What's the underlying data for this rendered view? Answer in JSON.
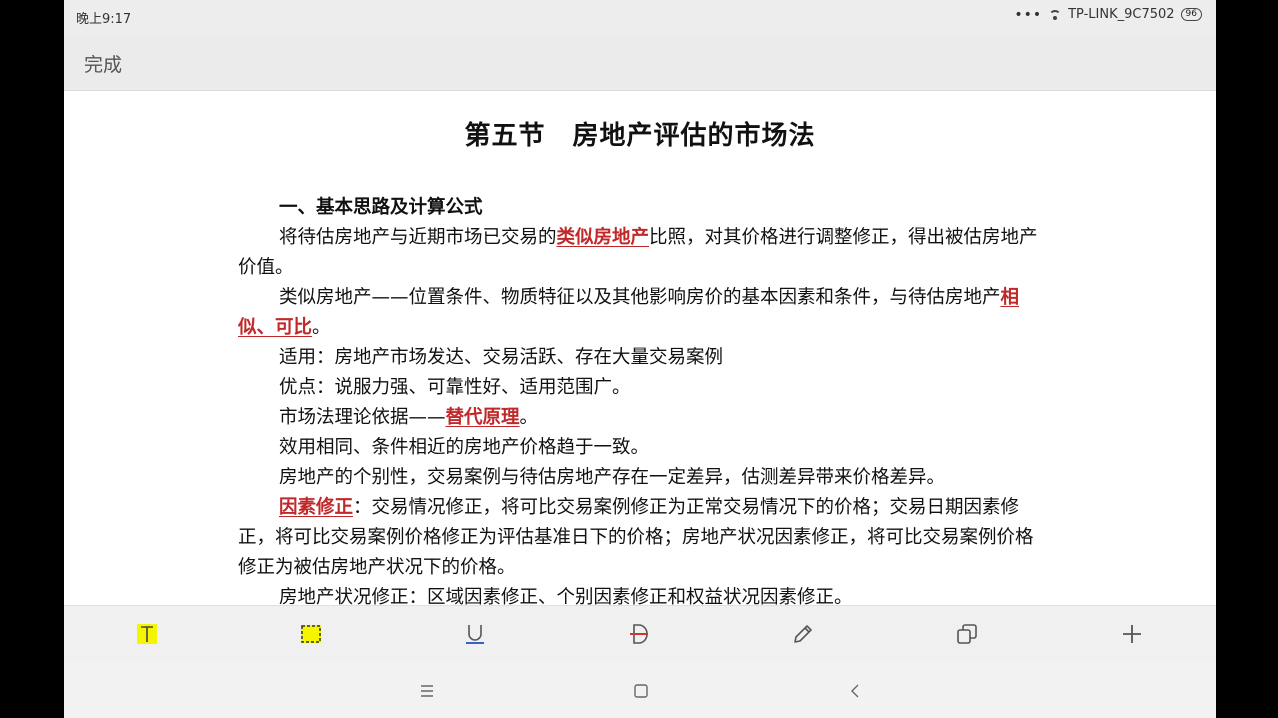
{
  "status": {
    "time": "晚上9:17",
    "more": "•••",
    "wifi_name": "TP-LINK_9C7502",
    "battery": "96"
  },
  "top_bar": {
    "done_label": "完成"
  },
  "document": {
    "title": "第五节　房地产评估的市场法",
    "heading1": "一、基本思路及计算公式",
    "p1": {
      "a": "将待估房地产与近期市场已交易的",
      "mark": "类似房地产",
      "b": "比照，对其价格进行调整修正，得出被估房地产价值。"
    },
    "p2": {
      "a": "类似房地产——位置条件、物质特征以及其他影响房价的基本因素和条件，与待估房地产",
      "mark": "相似、可比",
      "b": "。"
    },
    "p3": "适用：房地产市场发达、交易活跃、存在大量交易案例",
    "p4": "优点：说服力强、可靠性好、适用范围广。",
    "p5": {
      "a": "市场法理论依据——",
      "mark": "替代原理",
      "b": "。"
    },
    "p6": "效用相同、条件相近的房地产价格趋于一致。",
    "p7": "房地产的个别性，交易案例与待估房地产存在一定差异，估测差异带来价格差异。",
    "p8": {
      "mark": "因素修正",
      "b": "：交易情况修正，将可比交易案例修正为正常交易情况下的价格；交易日期因素修正，将可比交易案例价格修正为评估基准日下的价格；房地产状况因素修正，将可比交易案例价格修正为被估房地产状况下的价格。"
    },
    "p9": "房地产状况修正：区域因素修正、个别因素修正和权益状况因素修正。"
  },
  "toolbar": {
    "icons": [
      "highlight-text-icon",
      "select-area-icon",
      "underline-icon",
      "strikethrough-icon",
      "pencil-icon",
      "copy-icon",
      "add-icon"
    ],
    "highlight_color": "#f5f500",
    "underline_color": "#3a5fcd",
    "strike_color": "#d0342c",
    "mark_color": "#c0282a"
  },
  "navbar": {
    "icons": [
      "menu-icon",
      "home-icon",
      "back-icon"
    ]
  }
}
